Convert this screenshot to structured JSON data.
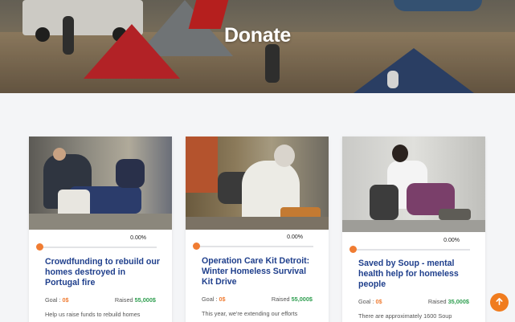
{
  "hero": {
    "title": "Donate"
  },
  "cards": [
    {
      "progress_label": "0.00%",
      "progress": 0,
      "title": "Crowdfunding to rebuild our homes destroyed in Portugal fire",
      "goal_label": "Goal : ",
      "goal_value": "0$",
      "raised_label": "Raised ",
      "raised_value": "55,000$",
      "description": "Help us raise funds to rebuild homes"
    },
    {
      "progress_label": "0.00%",
      "progress": 0,
      "title": "Operation Care Kit Detroit: Winter Homeless Survival Kit Drive",
      "goal_label": "Goal : ",
      "goal_value": "0$",
      "raised_label": "Raised ",
      "raised_value": "55,000$",
      "description": "This year, we're extending our efforts"
    },
    {
      "progress_label": "0.00%",
      "progress": 0,
      "title": "Saved by Soup - mental health help for homeless people",
      "goal_label": "Goal : ",
      "goal_value": "0$",
      "raised_label": "Raised ",
      "raised_value": "35,000$",
      "description": "There are approximately 1600 Soup"
    }
  ],
  "colors": {
    "accent": "#f07c32",
    "title": "#1f3f8c",
    "raised": "#2e9e4f"
  },
  "icons": {
    "back_to_top": "arrow-up-icon"
  }
}
